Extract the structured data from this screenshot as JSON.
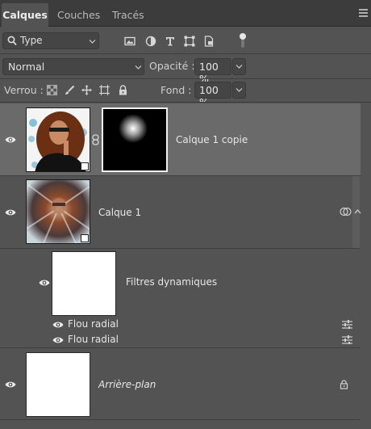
{
  "tabs": [
    {
      "label": "Calques",
      "active": true
    },
    {
      "label": "Couches",
      "active": false
    },
    {
      "label": "Tracés",
      "active": false
    }
  ],
  "filter": {
    "label": "Type",
    "icons": [
      "image-filter-icon",
      "adjustment-filter-icon",
      "text-filter-icon",
      "shape-filter-icon",
      "smart-object-filter-icon"
    ],
    "toggle_icon": "filter-toggle-icon"
  },
  "blend": {
    "mode": "Normal",
    "opacity_label": "Opacité :",
    "opacity_value": "100 %"
  },
  "lock": {
    "label": "Verrou :",
    "icons": [
      "lock-transparent-pixels-icon",
      "lock-image-pixels-icon",
      "lock-position-icon",
      "lock-artboard-icon",
      "lock-all-icon"
    ],
    "fill_label": "Fond :",
    "fill_value": "100 %"
  },
  "layers": [
    {
      "name": "Calque 1 copie",
      "selected": true,
      "visible": true,
      "has_mask": true,
      "smart_object": true
    },
    {
      "name": "Calque 1",
      "selected": false,
      "visible": true,
      "smart_object": true,
      "expanded": true,
      "smart_filters": {
        "label": "Filtres dynamiques",
        "filters": [
          {
            "name": "Flou radial"
          },
          {
            "name": "Flou radial"
          }
        ]
      }
    },
    {
      "name": "Arrière-plan",
      "selected": false,
      "visible": true,
      "locked": true,
      "italic": true
    }
  ],
  "colors": {
    "panel_bg": "#535353",
    "tab_bar_bg": "#3c3c3c",
    "selected_row": "#6a6a6a",
    "field_bg": "#454545"
  }
}
